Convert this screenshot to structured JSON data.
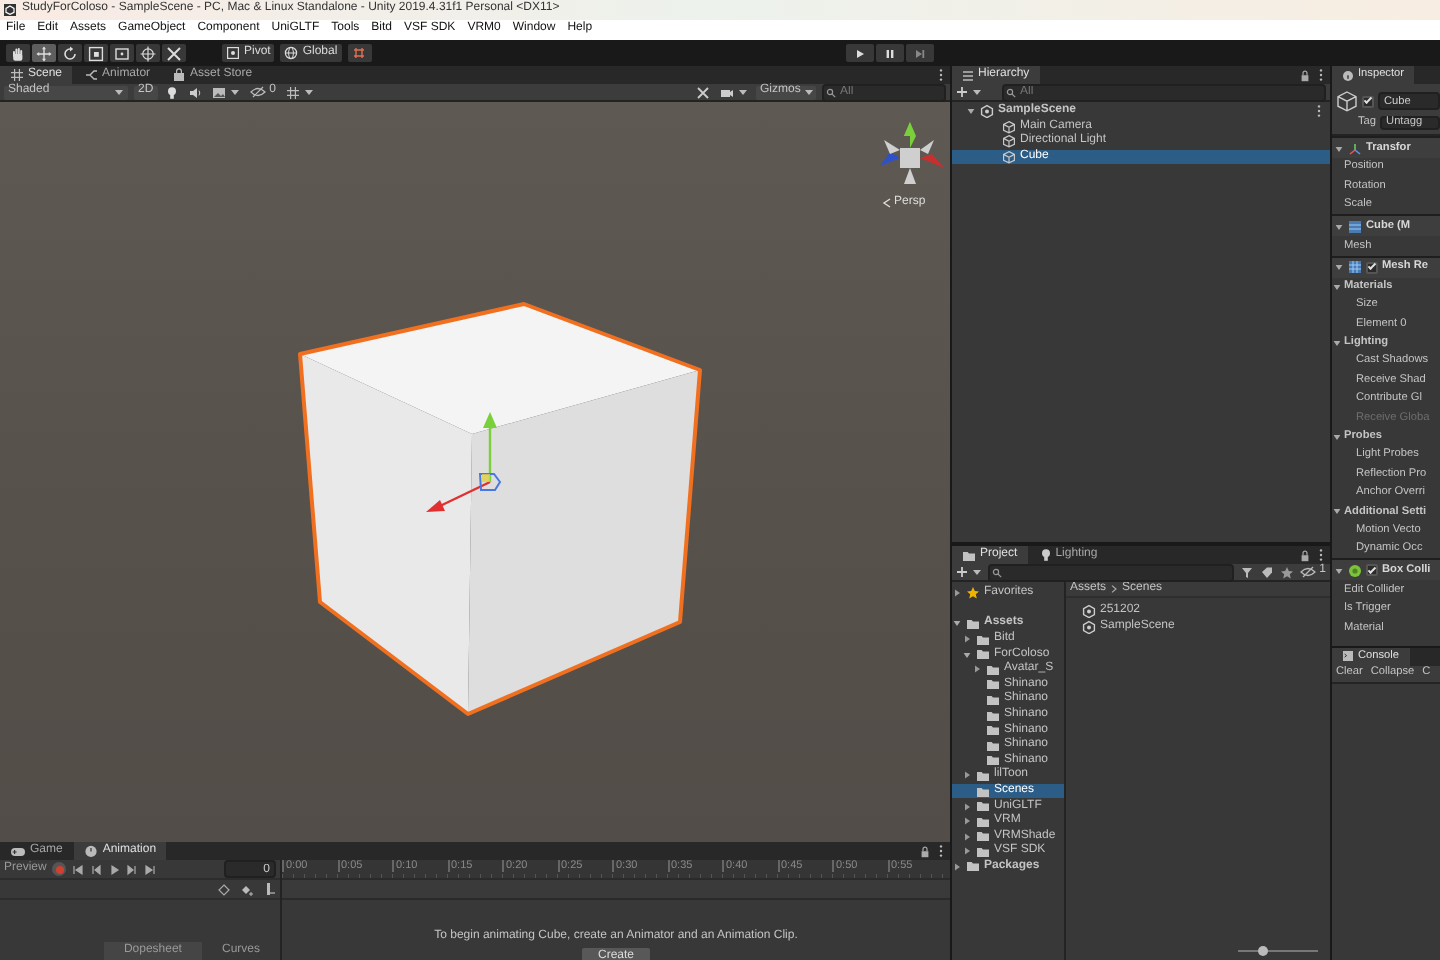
{
  "window": {
    "title": "StudyForColoso - SampleScene - PC, Mac & Linux Standalone - Unity 2019.4.31f1 Personal <DX11>"
  },
  "menu": [
    "File",
    "Edit",
    "Assets",
    "GameObject",
    "Component",
    "UniGLTF",
    "Tools",
    "Bitd",
    "VSF SDK",
    "VRM0",
    "Window",
    "Help"
  ],
  "toolbar": {
    "tools": [
      {
        "kind": "hand",
        "selected": false
      },
      {
        "kind": "move",
        "selected": true
      },
      {
        "kind": "rotate",
        "selected": false
      },
      {
        "kind": "scale",
        "selected": false
      },
      {
        "kind": "rect",
        "selected": false
      },
      {
        "kind": "transform",
        "selected": false
      },
      {
        "kind": "custom",
        "selected": false
      }
    ],
    "pivot": "Pivot",
    "global": "Global"
  },
  "scene": {
    "tabs": [
      {
        "label": "Scene",
        "kind": "scene",
        "selected": true
      },
      {
        "label": "Animator",
        "kind": "animator",
        "selected": false
      },
      {
        "label": "Asset Store",
        "kind": "store",
        "selected": false
      }
    ],
    "shading": "Shaded",
    "view_2d": "2D",
    "hidden_count": "0",
    "gizmos": "Gizmos",
    "search": {
      "placeholder": "All"
    },
    "projection": "Persp"
  },
  "hierarchy": {
    "tab": "Hierarchy",
    "search": {
      "placeholder": "All"
    },
    "tree": [
      {
        "label": "SampleScene",
        "kind": "scene",
        "expanded": true,
        "selected": false,
        "children": [
          {
            "label": "Main Camera",
            "kind": "object",
            "selected": false
          },
          {
            "label": "Directional Light",
            "kind": "object",
            "selected": false
          },
          {
            "label": "Cube",
            "kind": "object",
            "selected": true
          }
        ]
      }
    ]
  },
  "project": {
    "tabs": [
      {
        "label": "Project",
        "kind": "project",
        "selected": true
      },
      {
        "label": "Lighting",
        "kind": "lighting",
        "selected": false
      }
    ],
    "hidden_count": "1",
    "tree": [
      {
        "label": "Favorites",
        "kind": "favorites",
        "expanded": false,
        "selected": false
      },
      {
        "label": "Assets",
        "kind": "root",
        "expanded": true,
        "selected": false,
        "children": [
          {
            "label": "Bitd",
            "kind": "folder",
            "expanded": false,
            "selected": false
          },
          {
            "label": "ForColoso",
            "kind": "folder",
            "expanded": true,
            "selected": false,
            "children": [
              {
                "label": "Avatar_S",
                "kind": "folder",
                "expanded": false,
                "selected": false
              },
              {
                "label": "Shinano",
                "kind": "folder",
                "selected": false
              },
              {
                "label": "Shinano",
                "kind": "folder",
                "selected": false
              },
              {
                "label": "Shinano",
                "kind": "folder",
                "selected": false
              },
              {
                "label": "Shinano",
                "kind": "folder",
                "selected": false
              },
              {
                "label": "Shinano",
                "kind": "folder",
                "selected": false
              },
              {
                "label": "Shinano",
                "kind": "folder",
                "selected": false
              }
            ]
          },
          {
            "label": "lilToon",
            "kind": "folder",
            "expanded": false,
            "selected": false
          },
          {
            "label": "Scenes",
            "kind": "folder",
            "selected": true
          },
          {
            "label": "UniGLTF",
            "kind": "folder",
            "expanded": false,
            "selected": false
          },
          {
            "label": "VRM",
            "kind": "folder",
            "expanded": false,
            "selected": false
          },
          {
            "label": "VRMShade",
            "kind": "folder",
            "expanded": false,
            "selected": false
          },
          {
            "label": "VSF SDK",
            "kind": "folder",
            "expanded": false,
            "selected": false
          }
        ]
      },
      {
        "label": "Packages",
        "kind": "root",
        "expanded": false,
        "selected": false
      }
    ],
    "breadcrumb": [
      "Assets",
      "Scenes"
    ],
    "files": [
      {
        "label": "251202",
        "selected": false
      },
      {
        "label": "SampleScene",
        "selected": false
      }
    ],
    "icon_size": {
      "level": 0.3
    }
  },
  "inspector": {
    "tab": "Inspector",
    "object": {
      "active": true,
      "name": "Cube"
    },
    "tag_label": "Tag",
    "tag": "Untagg",
    "components": [
      {
        "label": "Transfor",
        "kind": "transform",
        "expanded": true,
        "children": [
          {
            "label": "Position",
            "disabled": false
          },
          {
            "label": "Rotation",
            "disabled": false
          },
          {
            "label": "Scale",
            "disabled": false
          }
        ]
      },
      {
        "label": "Cube (M",
        "kind": "mesh_filter",
        "expanded": true,
        "children": [
          {
            "label": "Mesh",
            "disabled": false
          }
        ]
      },
      {
        "label": "Mesh Re",
        "kind": "mesh_renderer",
        "checked": true,
        "expanded": true,
        "children": [
          {
            "label": "Materials",
            "expanded": true,
            "children": [
              {
                "label": "Size",
                "disabled": false
              },
              {
                "label": "Element 0",
                "disabled": false
              }
            ]
          },
          {
            "label": "Lighting",
            "expanded": true,
            "children": [
              {
                "label": "Cast Shadows",
                "disabled": false
              },
              {
                "label": "Receive Shad",
                "disabled": false
              },
              {
                "label": "Contribute Gl",
                "disabled": false
              },
              {
                "label": "Receive Globa",
                "disabled": true
              }
            ]
          },
          {
            "label": "Probes",
            "expanded": true,
            "children": [
              {
                "label": "Light Probes",
                "disabled": false
              },
              {
                "label": "Reflection Pro",
                "disabled": false
              },
              {
                "label": "Anchor Overri",
                "disabled": false
              }
            ]
          },
          {
            "label": "Additional Setti",
            "expanded": true,
            "children": [
              {
                "label": "Motion Vecto",
                "disabled": false
              },
              {
                "label": "Dynamic Occ",
                "disabled": false
              }
            ]
          }
        ]
      },
      {
        "label": "Box Colli",
        "kind": "collider",
        "checked": true,
        "expanded": true,
        "children": [
          {
            "label": "Edit Collider",
            "disabled": false
          },
          {
            "label": "Is Trigger",
            "disabled": false
          },
          {
            "label": "Material",
            "disabled": false
          }
        ]
      }
    ],
    "console": {
      "tab": "Console",
      "buttons": [
        "Clear",
        "Collapse",
        "C"
      ]
    }
  },
  "animation": {
    "tabs": [
      {
        "label": "Game",
        "kind": "game",
        "selected": false
      },
      {
        "label": "Animation",
        "kind": "animation",
        "selected": true
      }
    ],
    "preview": "Preview",
    "frame": "0",
    "ticks": [
      "0:00",
      "0:05",
      "0:10",
      "0:15",
      "0:20",
      "0:25",
      "0:30",
      "0:35",
      "0:40",
      "0:45",
      "0:50",
      "0:55"
    ],
    "message": "To begin animating Cube, create an Animator and an Animation Clip.",
    "create": "Create",
    "views": [
      {
        "label": "Dopesheet",
        "selected": true
      },
      {
        "label": "Curves",
        "selected": false
      }
    ]
  }
}
